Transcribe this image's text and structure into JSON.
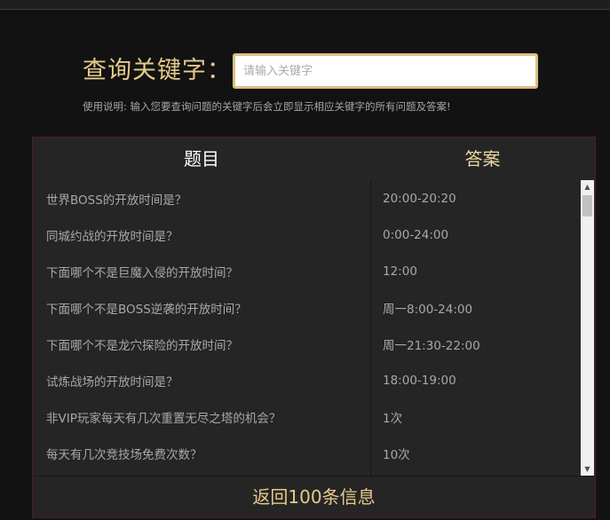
{
  "search": {
    "label": "查询关键字：",
    "placeholder": "请输入关键字",
    "usage": "使用说明: 输入您要查询问题的关键字后会立即显示相应关键字的所有问题及答案!"
  },
  "table": {
    "headers": {
      "question": "题目",
      "answer": "答案"
    },
    "rows": [
      {
        "q": "世界BOSS的开放时间是？",
        "a": "20:00-20:20"
      },
      {
        "q": "同城约战的开放时间是？",
        "a": "0:00-24:00"
      },
      {
        "q": "下面哪个不是巨魔入侵的开放时间？",
        "a": "12:00"
      },
      {
        "q": "下面哪个不是BOSS逆袭的开放时间？",
        "a": "周一8:00-24:00"
      },
      {
        "q": "下面哪个不是龙穴探险的开放时间？",
        "a": "周一21:30-22:00"
      },
      {
        "q": "试炼战场的开放时间是？",
        "a": "18:00-19:00"
      },
      {
        "q": "非VIP玩家每天有几次重置无尽之塔的机会？",
        "a": "1次"
      },
      {
        "q": "每天有几次竞技场免费次数？",
        "a": "10次"
      }
    ],
    "footer": "返回100条信息"
  },
  "colors": {
    "background": "#121212",
    "accent_gold": "#e6c98a",
    "panel": "#252525",
    "panel_border": "#5c1a1a"
  },
  "icons": {
    "scroll_up": "triangle-up",
    "scroll_down": "triangle-down"
  }
}
